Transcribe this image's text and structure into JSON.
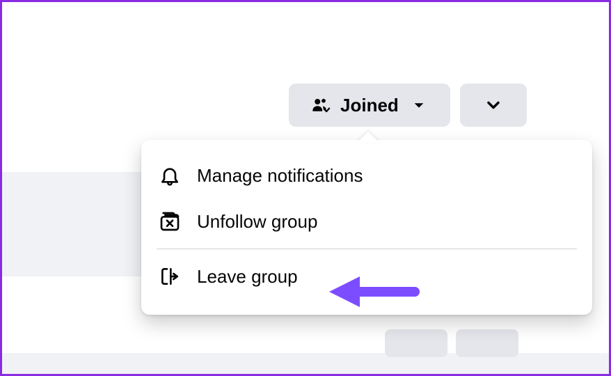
{
  "buttons": {
    "joined_label": "Joined"
  },
  "menu": {
    "items": [
      {
        "label": "Manage notifications"
      },
      {
        "label": "Unfollow group"
      },
      {
        "label": "Leave group"
      }
    ]
  },
  "annotation": {
    "arrow_color": "#7c4dff"
  }
}
